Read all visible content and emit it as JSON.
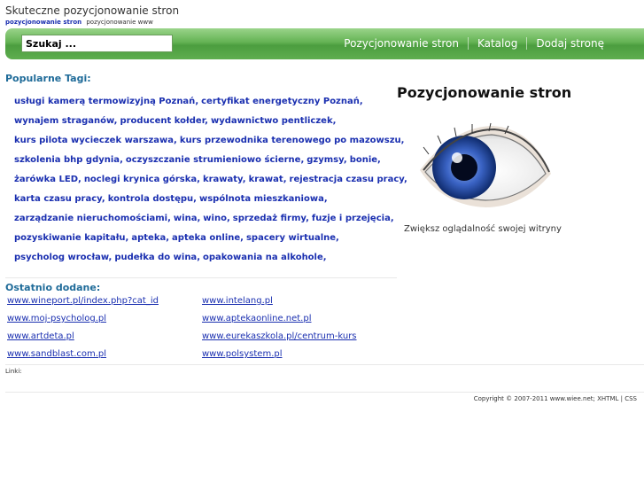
{
  "header": {
    "site_title": "Skuteczne pozycjonowanie stron",
    "tagline_brand": "pozycjonowanie stron",
    "tagline_text": "pozycjonowanie www"
  },
  "navbar": {
    "search_value": "Szukaj ...",
    "links": [
      "Pozycjonowanie stron",
      "Katalog",
      "Dodaj stronę"
    ]
  },
  "tags": {
    "heading": "Popularne Tagi:",
    "lines": [
      [
        "usługi kamerą termowizyjną Poznań",
        "certyfikat energetyczny Poznań"
      ],
      [
        "wynajem straganów",
        "producent kołder",
        "wydawnictwo pentliczek"
      ],
      [
        "kurs pilota wycieczek warszawa",
        "kurs przewodnika terenowego po mazowszu"
      ],
      [
        "szkolenia bhp gdynia",
        "oczyszczanie strumieniowo ścierne",
        "gzymsy",
        "bonie"
      ],
      [
        "żarówka LED",
        "noclegi krynica górska",
        "krawaty",
        "krawat",
        "rejestracja czasu pracy"
      ],
      [
        "karta czasu pracy",
        "kontrola dostępu",
        "wspólnota mieszkaniowa"
      ],
      [
        "zarządzanie nieruchomościami",
        "wina",
        "wino",
        "sprzedaż firmy",
        "fuzje i przejęcia"
      ],
      [
        "pozyskiwanie kapitału",
        "apteka",
        "apteka online",
        "spacery wirtualne"
      ],
      [
        "psycholog wrocław",
        "pudełka do wina",
        "opakowania na alkohole"
      ]
    ]
  },
  "recent": {
    "heading": "Ostatnio dodane:",
    "rows": [
      [
        "www.wineport.pl/index.php?cat_id",
        "www.intelang.pl"
      ],
      [
        "www.moj-psycholog.pl",
        "www.aptekaonline.net.pl"
      ],
      [
        "www.artdeta.pl",
        "www.eurekaszkola.pl/centrum-kurs"
      ],
      [
        "www.sandblast.com.pl",
        "www.polsystem.pl"
      ]
    ]
  },
  "links_label": "Linki:",
  "footer": {
    "copyright": "Copyright © 2007-2011 www.wiee.net;",
    "xhtml": "XHTML",
    "pipe": "|",
    "css": "CSS"
  },
  "side": {
    "title": "Pozycjonowanie stron",
    "text": "Zwiększ oglądalność swojej witryny"
  },
  "colors": {
    "link": "#1a2fb0",
    "heading": "#1f6b99",
    "nav_green": "#5fae4f",
    "iris": "#3a63c4"
  }
}
